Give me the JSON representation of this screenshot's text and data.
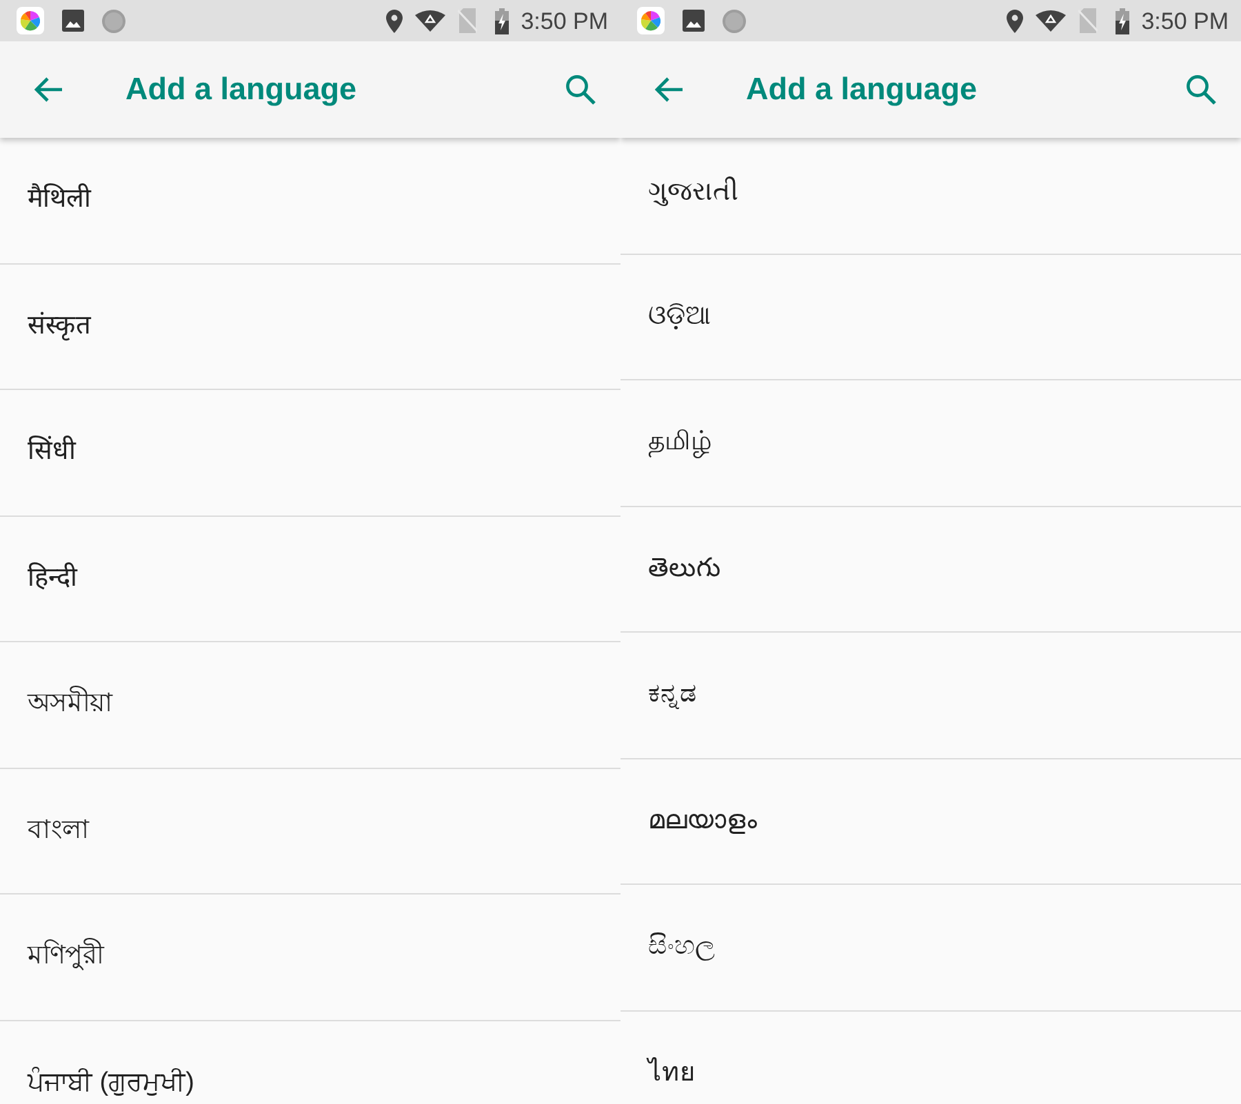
{
  "screens": [
    {
      "status_bar": {
        "time": "3:50 PM"
      },
      "app_bar": {
        "title": "Add a language"
      },
      "languages": [
        "मैथिली",
        "संस्कृत",
        "सिंधी",
        "हिन्दी",
        "অসমীয়া",
        "বাংলা",
        "মণিপুরী",
        "ਪੰਜਾਬੀ (ਗੁਰਮੁਖੀ)"
      ]
    },
    {
      "status_bar": {
        "time": "3:50 PM"
      },
      "app_bar": {
        "title": "Add a language"
      },
      "languages": [
        "ગુજરાતી",
        "ଓଡ଼ିଆ",
        "தமிழ்",
        "తెలుగు",
        "ಕನ್ನಡ",
        "മലയാളം",
        "සිංහල",
        "ไทย"
      ]
    }
  ]
}
